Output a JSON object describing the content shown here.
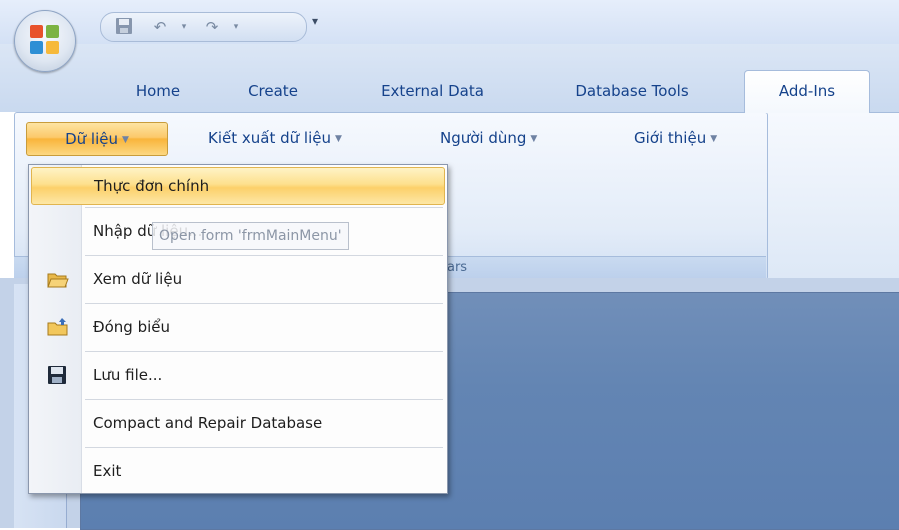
{
  "quick_access": {
    "undo_icon": "undo-icon",
    "redo_icon": "redo-icon",
    "save_icon": "save-icon",
    "customize": "▾"
  },
  "tabs": [
    {
      "label": "Home"
    },
    {
      "label": "Create"
    },
    {
      "label": "External Data"
    },
    {
      "label": "Database Tools"
    },
    {
      "label": "Add-Ins"
    }
  ],
  "ribbon": {
    "menus": [
      {
        "label": "Dữ liệu"
      },
      {
        "label": "Kiết xuất dữ liệu"
      },
      {
        "label": "Người dùng"
      },
      {
        "label": "Giới thiệu"
      }
    ],
    "group_caption": "ars"
  },
  "dropdown": {
    "items": [
      {
        "label": "Thực đơn chính",
        "icon": ""
      },
      {
        "label": "Nhập dữ liệu...",
        "icon": ""
      },
      {
        "label": "Xem dữ liệu",
        "icon": "open-folder-icon"
      },
      {
        "label": "Đóng biểu",
        "icon": "folder-close-icon"
      },
      {
        "label": "Lưu file...",
        "icon": "save-icon"
      },
      {
        "label": "Compact and Repair Database",
        "icon": ""
      },
      {
        "label": "Exit",
        "icon": ""
      }
    ]
  },
  "tooltip": "Open form 'frmMainMenu'",
  "colors": {
    "accent": "#fcc96a",
    "ribbon_text": "#15428b",
    "workspace": "#6385b3"
  }
}
